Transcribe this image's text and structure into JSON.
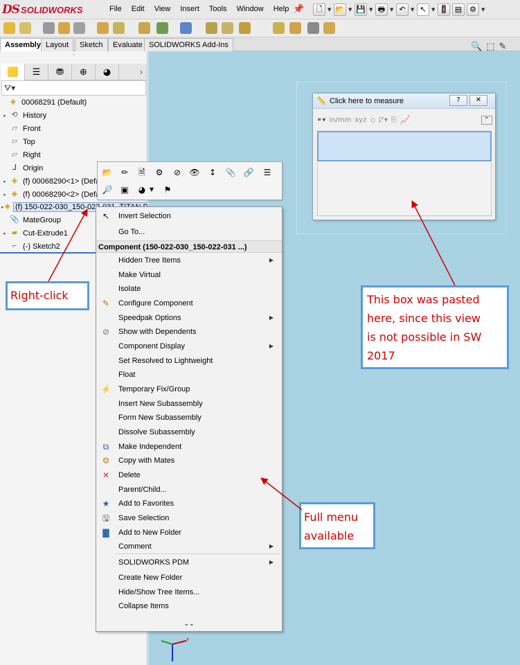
{
  "app": {
    "logo_ds": "DS",
    "logo_name": "SOLIDWORKS"
  },
  "menubar": {
    "items": [
      "File",
      "Edit",
      "View",
      "Insert",
      "Tools",
      "Window",
      "Help"
    ]
  },
  "ribbon_tabs": [
    {
      "label": "Assembly",
      "active": true
    },
    {
      "label": "Layout",
      "active": false
    },
    {
      "label": "Sketch",
      "active": false
    },
    {
      "label": "Evaluate",
      "active": false
    },
    {
      "label": "SOLIDWORKS Add-Ins",
      "active": false
    }
  ],
  "tree": {
    "root": "00068291  (Default)",
    "items": [
      {
        "label": "History",
        "icon": "history-icon",
        "expandable": true
      },
      {
        "label": "Front",
        "icon": "plane-icon",
        "expandable": false
      },
      {
        "label": "Top",
        "icon": "plane-icon",
        "expandable": false
      },
      {
        "label": "Right",
        "icon": "plane-icon",
        "expandable": false
      },
      {
        "label": "Origin",
        "icon": "origin-icon",
        "expandable": false
      },
      {
        "label": "(f) 00068290<1> (Defa",
        "icon": "part-icon",
        "expandable": true
      },
      {
        "label": "(f) 00068290<2> (Defa",
        "icon": "part-icon",
        "expandable": true
      },
      {
        "label": "(f) 150-022-030_150-022-031_TITAN P",
        "icon": "part-icon",
        "expandable": true,
        "selected": true
      },
      {
        "label": "MateGroup",
        "icon": "mates-icon",
        "expandable": false
      },
      {
        "label": "Cut-Extrude1",
        "icon": "extrude-icon",
        "expandable": true
      },
      {
        "label": "(-) Sketch2",
        "icon": "sketch-icon",
        "expandable": false
      }
    ]
  },
  "measure": {
    "title": "Click here to measure",
    "help": "?",
    "close": "✕"
  },
  "context_menu": {
    "top_items": [
      "Invert Selection",
      "Go To..."
    ],
    "header": "Component (150-022-030_150-022-031 ...)",
    "items": [
      {
        "label": "Hidden Tree Items",
        "submenu": true,
        "icon": ""
      },
      {
        "label": "Make Virtual",
        "submenu": false,
        "icon": ""
      },
      {
        "label": "Isolate",
        "submenu": false,
        "icon": ""
      },
      {
        "label": "Configure Component",
        "submenu": false,
        "icon": "configure-icon"
      },
      {
        "label": "Speedpak Options",
        "submenu": true,
        "icon": ""
      },
      {
        "label": "Show with Dependents",
        "submenu": false,
        "icon": "show-icon"
      },
      {
        "label": "Component Display",
        "submenu": true,
        "icon": ""
      },
      {
        "label": "Set Resolved to Lightweight",
        "submenu": false,
        "icon": ""
      },
      {
        "label": "Float",
        "submenu": false,
        "icon": ""
      },
      {
        "label": "Temporary Fix/Group",
        "submenu": false,
        "icon": "fix-icon"
      },
      {
        "label": "Insert New Subassembly",
        "submenu": false,
        "icon": ""
      },
      {
        "label": "Form New Subassembly",
        "submenu": false,
        "icon": ""
      },
      {
        "label": "Dissolve Subassembly",
        "submenu": false,
        "icon": ""
      },
      {
        "label": "Make Independent",
        "submenu": false,
        "icon": "independent-icon"
      },
      {
        "label": "Copy with Mates",
        "submenu": false,
        "icon": "copy-mates-icon"
      },
      {
        "label": "Delete",
        "submenu": false,
        "icon": "delete-icon"
      },
      {
        "label": "Parent/Child...",
        "submenu": false,
        "icon": ""
      },
      {
        "label": "Add to Favorites",
        "submenu": false,
        "icon": "favorites-icon"
      },
      {
        "label": "Save Selection",
        "submenu": false,
        "icon": "save-selection-icon"
      },
      {
        "label": "Add to New Folder",
        "submenu": false,
        "icon": "folder-icon"
      },
      {
        "label": "Comment",
        "submenu": true,
        "icon": ""
      }
    ],
    "bottom_items": [
      {
        "label": "SOLIDWORKS PDM",
        "submenu": true
      },
      {
        "label": "Create New Folder",
        "submenu": false
      },
      {
        "label": "Hide/Show Tree Items...",
        "submenu": false
      },
      {
        "label": "Collapse Items",
        "submenu": false
      }
    ],
    "more": "⌄⌄"
  },
  "callouts": {
    "right_click": "Right-click",
    "pasted": [
      "This box was pasted",
      "here, since this view",
      "is not possible in SW",
      "2017"
    ],
    "full_menu": [
      "Full menu",
      "available"
    ]
  },
  "colors": {
    "accent": "#5b9bd5",
    "callout_text": "#d00000",
    "graphics_bg": "#a9d2e3"
  }
}
